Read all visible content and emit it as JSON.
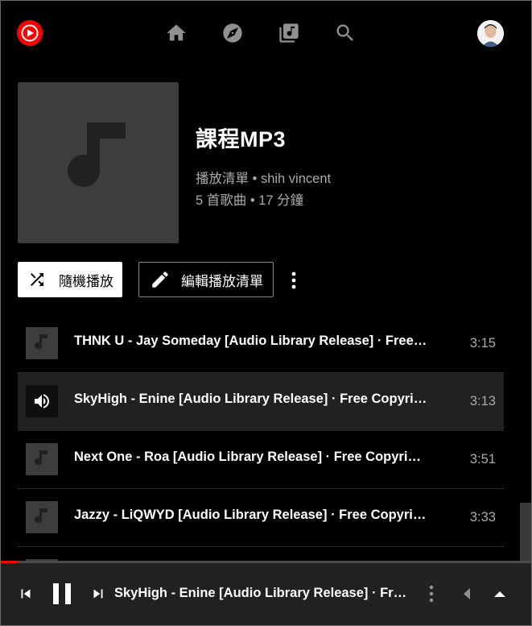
{
  "app": {
    "name": "YouTube Music"
  },
  "nav": {
    "icons": [
      "home-icon",
      "explore-icon",
      "library-icon",
      "search-icon"
    ]
  },
  "playlist": {
    "title": "課程MP3",
    "meta_line1": "播放清單 • shih vincent",
    "meta_line2": "5 首歌曲 • 17 分鐘",
    "shuffle_label": "隨機播放",
    "edit_label": "編輯播放清單"
  },
  "tracks": [
    {
      "title": "THNK U - Jay Someday [Audio Library Release] · Free …",
      "duration": "3:15",
      "playing": false
    },
    {
      "title": "SkyHigh - Enine [Audio Library Release] · Free Copyrig…",
      "duration": "3:13",
      "playing": true
    },
    {
      "title": "Next One - Roa [Audio Library Release] · Free Copyrig…",
      "duration": "3:51",
      "playing": false
    },
    {
      "title": "Jazzy - LiQWYD [Audio Library Release] · Free Copyri…",
      "duration": "3:33",
      "playing": false
    }
  ],
  "player": {
    "now_playing": "SkyHigh - Enine [Audio Library Release] · Free…",
    "progress": 0.03,
    "accent": "#ff0000"
  }
}
